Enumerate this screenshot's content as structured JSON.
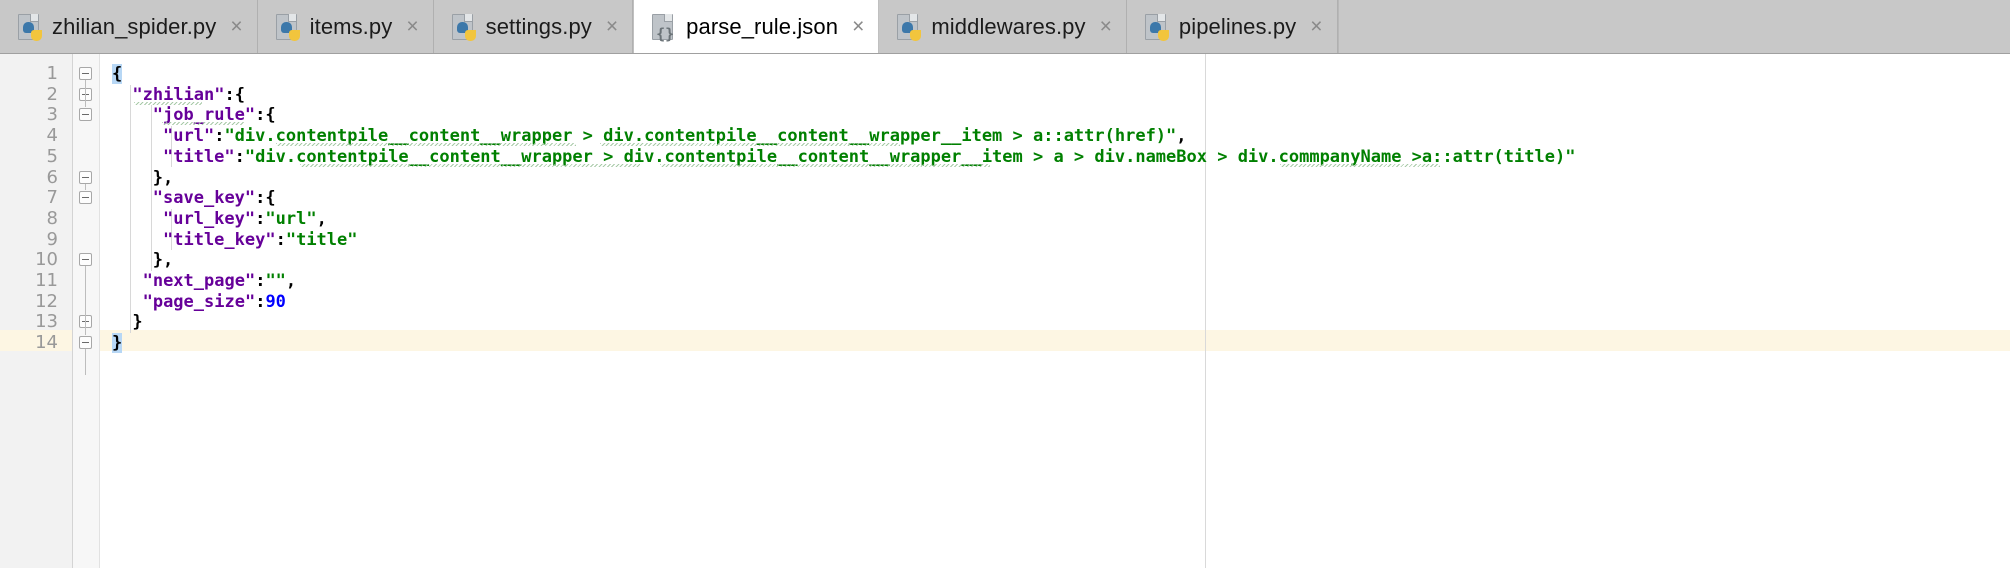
{
  "window": {
    "title": "parse_rule.json"
  },
  "tabs": [
    {
      "label": "zhilian_spider.py",
      "icon": "python-file-icon",
      "active": false,
      "close": "×"
    },
    {
      "label": "items.py",
      "icon": "python-file-icon",
      "active": false,
      "close": "×"
    },
    {
      "label": "settings.py",
      "icon": "python-file-icon",
      "active": false,
      "close": "×"
    },
    {
      "label": "parse_rule.json",
      "icon": "json-file-icon",
      "active": true,
      "close": "×"
    },
    {
      "label": "middlewares.py",
      "icon": "python-file-icon",
      "active": false,
      "close": "×"
    },
    {
      "label": "pipelines.py",
      "icon": "python-file-icon",
      "active": false,
      "close": "×"
    }
  ],
  "editor": {
    "language": "json",
    "line_numbers": [
      "1",
      "2",
      "3",
      "4",
      "5",
      "6",
      "7",
      "8",
      "9",
      "10",
      "11",
      "12",
      "13",
      "14"
    ],
    "current_line": 14,
    "colors": {
      "key": "#660099",
      "string": "#008000",
      "number": "#0000ff",
      "punctuation": "#000000",
      "current_line_bg": "#fdf6e3",
      "brace_match_bg": "#b7d7f5",
      "gutter_bg": "#f2f2f2",
      "background": "#ffffff"
    },
    "lines": [
      {
        "n": 1,
        "indent": 0,
        "tokens": [
          {
            "t": "{",
            "c": "brace-hl"
          }
        ]
      },
      {
        "n": 2,
        "indent": 2,
        "tokens": [
          {
            "t": "\"zhilian\"",
            "c": "key"
          },
          {
            "t": ":{",
            "c": "punct"
          }
        ]
      },
      {
        "n": 3,
        "indent": 4,
        "tokens": [
          {
            "t": "\"job_rule\"",
            "c": "key"
          },
          {
            "t": ":{",
            "c": "punct"
          }
        ]
      },
      {
        "n": 4,
        "indent": 5,
        "tokens": [
          {
            "t": "\"url\"",
            "c": "key"
          },
          {
            "t": ":",
            "c": "punct"
          },
          {
            "t": "\"div.contentpile__content__wrapper > div.contentpile__content__wrapper__item > a::attr(href)\"",
            "c": "str"
          },
          {
            "t": ",",
            "c": "punct"
          }
        ]
      },
      {
        "n": 5,
        "indent": 5,
        "tokens": [
          {
            "t": "\"title\"",
            "c": "key"
          },
          {
            "t": ":",
            "c": "punct"
          },
          {
            "t": "\"div.contentpile__content__wrapper > div.contentpile__content__wrapper__item > a > div.nameBox > div.commpanyName >a::attr(title)\"",
            "c": "str"
          }
        ]
      },
      {
        "n": 6,
        "indent": 4,
        "tokens": [
          {
            "t": "},",
            "c": "punct"
          }
        ]
      },
      {
        "n": 7,
        "indent": 4,
        "tokens": [
          {
            "t": "\"save_key\"",
            "c": "key"
          },
          {
            "t": ":{",
            "c": "punct"
          }
        ]
      },
      {
        "n": 8,
        "indent": 5,
        "tokens": [
          {
            "t": "\"url_key\"",
            "c": "key"
          },
          {
            "t": ":",
            "c": "punct"
          },
          {
            "t": "\"url\"",
            "c": "str"
          },
          {
            "t": ",",
            "c": "punct"
          }
        ]
      },
      {
        "n": 9,
        "indent": 5,
        "tokens": [
          {
            "t": "\"title_key\"",
            "c": "key"
          },
          {
            "t": ":",
            "c": "punct"
          },
          {
            "t": "\"title\"",
            "c": "str"
          }
        ]
      },
      {
        "n": 10,
        "indent": 4,
        "tokens": [
          {
            "t": "},",
            "c": "punct"
          }
        ]
      },
      {
        "n": 11,
        "indent": 3,
        "tokens": [
          {
            "t": "\"next_page\"",
            "c": "key"
          },
          {
            "t": ":",
            "c": "punct"
          },
          {
            "t": "\"\"",
            "c": "str"
          },
          {
            "t": ",",
            "c": "punct"
          }
        ]
      },
      {
        "n": 12,
        "indent": 3,
        "tokens": [
          {
            "t": "\"page_size\"",
            "c": "key"
          },
          {
            "t": ":",
            "c": "punct"
          },
          {
            "t": "90",
            "c": "num"
          }
        ]
      },
      {
        "n": 13,
        "indent": 2,
        "tokens": [
          {
            "t": "}",
            "c": "punct"
          }
        ]
      },
      {
        "n": 14,
        "indent": 0,
        "tokens": [
          {
            "t": "}",
            "c": "brace-hl"
          }
        ]
      }
    ]
  }
}
